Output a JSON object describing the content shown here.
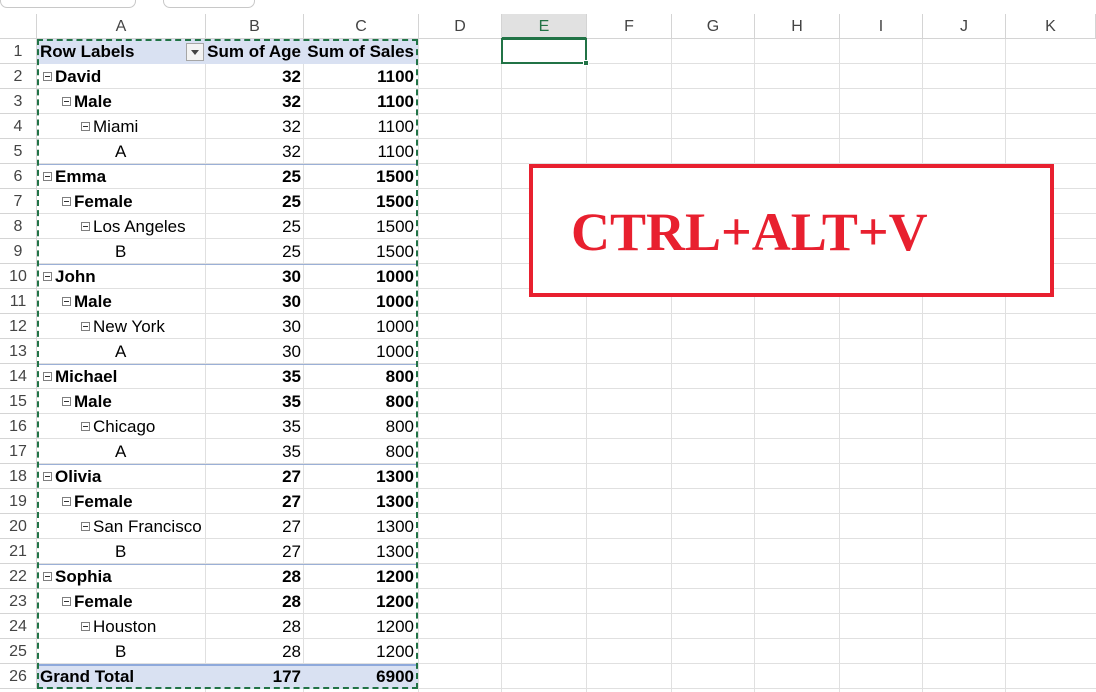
{
  "columns": [
    "A",
    "B",
    "C",
    "D",
    "E",
    "F",
    "G",
    "H",
    "I",
    "J",
    "K"
  ],
  "selected_column": "E",
  "rows": [
    "1",
    "2",
    "3",
    "4",
    "5",
    "6",
    "7",
    "8",
    "9",
    "10",
    "11",
    "12",
    "13",
    "14",
    "15",
    "16",
    "17",
    "18",
    "19",
    "20",
    "21",
    "22",
    "23",
    "24",
    "25",
    "26"
  ],
  "pivot": {
    "header": {
      "row_labels": "Row Labels",
      "sum_age": "Sum of Age",
      "sum_sales": "Sum of Sales"
    },
    "rows": [
      {
        "label": "David",
        "level": 0,
        "age": "32",
        "sales": "1100"
      },
      {
        "label": "Male",
        "level": 1,
        "age": "32",
        "sales": "1100"
      },
      {
        "label": "Miami",
        "level": 2,
        "age": "32",
        "sales": "1100"
      },
      {
        "label": "A",
        "level": 3,
        "age": "32",
        "sales": "1100"
      },
      {
        "label": "Emma",
        "level": 0,
        "age": "25",
        "sales": "1500"
      },
      {
        "label": "Female",
        "level": 1,
        "age": "25",
        "sales": "1500"
      },
      {
        "label": "Los Angeles",
        "level": 2,
        "age": "25",
        "sales": "1500"
      },
      {
        "label": "B",
        "level": 3,
        "age": "25",
        "sales": "1500"
      },
      {
        "label": "John",
        "level": 0,
        "age": "30",
        "sales": "1000"
      },
      {
        "label": "Male",
        "level": 1,
        "age": "30",
        "sales": "1000"
      },
      {
        "label": "New York",
        "level": 2,
        "age": "30",
        "sales": "1000"
      },
      {
        "label": "A",
        "level": 3,
        "age": "30",
        "sales": "1000"
      },
      {
        "label": "Michael",
        "level": 0,
        "age": "35",
        "sales": "800"
      },
      {
        "label": "Male",
        "level": 1,
        "age": "35",
        "sales": "800"
      },
      {
        "label": "Chicago",
        "level": 2,
        "age": "35",
        "sales": "800"
      },
      {
        "label": "A",
        "level": 3,
        "age": "35",
        "sales": "800"
      },
      {
        "label": "Olivia",
        "level": 0,
        "age": "27",
        "sales": "1300"
      },
      {
        "label": "Female",
        "level": 1,
        "age": "27",
        "sales": "1300"
      },
      {
        "label": "San Francisco",
        "level": 2,
        "age": "27",
        "sales": "1300"
      },
      {
        "label": "B",
        "level": 3,
        "age": "27",
        "sales": "1300"
      },
      {
        "label": "Sophia",
        "level": 0,
        "age": "28",
        "sales": "1200"
      },
      {
        "label": "Female",
        "level": 1,
        "age": "28",
        "sales": "1200"
      },
      {
        "label": "Houston",
        "level": 2,
        "age": "28",
        "sales": "1200"
      },
      {
        "label": "B",
        "level": 3,
        "age": "28",
        "sales": "1200"
      }
    ],
    "grand_total": {
      "label": "Grand Total",
      "age": "177",
      "sales": "6900"
    }
  },
  "callout": {
    "text": "CTRL+ALT+V",
    "color": "#e8202f"
  },
  "colors": {
    "accent": "#217346",
    "pivot_header_bg": "#d9e1f2"
  },
  "icons": {
    "filter": "dropdown-arrow-icon",
    "collapse": "minus-box-icon"
  }
}
